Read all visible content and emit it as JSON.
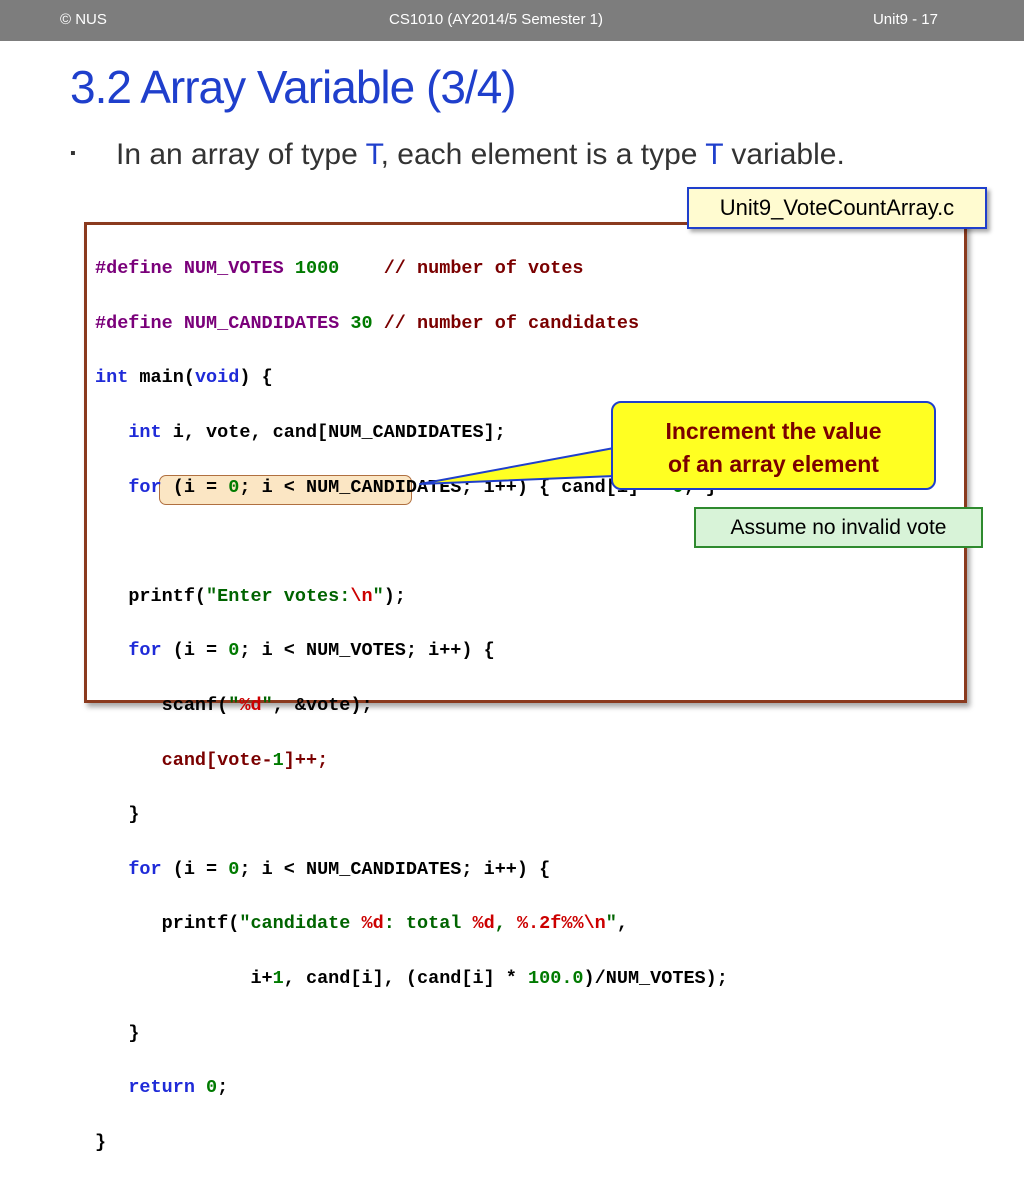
{
  "header": {
    "left": "© NUS",
    "center": "CS1010 (AY2014/5 Semester 1)",
    "right": "Unit9 - 17"
  },
  "title": "3.2 Array Variable (3/4)",
  "bullet": {
    "marker": "▪",
    "part1": "In an array of type ",
    "t1": "T",
    "part2": ", each element is a type ",
    "t2": "T",
    "part3": " variable."
  },
  "filename": "Unit9_VoteCountArray.c",
  "code": {
    "l1_define": "#define",
    "l1_name": "NUM_VOTES",
    "l1_value": "1000",
    "l1_comment": "// number of votes",
    "l2_define": "#define",
    "l2_name": "NUM_CANDIDATES",
    "l2_value": "30",
    "l2_comment": "// number of candidates",
    "l3_type": "int",
    "l3_main": " main(",
    "l3_void": "void",
    "l3_end": ") {",
    "l4_type": "int",
    "l4_rest": " i, vote, cand[NUM_CANDIDATES];",
    "l5_for": "for",
    "l5_a": " (i = ",
    "l5_zero": "0",
    "l5_b": "; i < NUM_CANDIDATES; i++) { cand[i] = ",
    "l5_zero2": "0",
    "l5_c": "; }",
    "l6_printf": "printf(",
    "l6_str": "\"Enter votes:",
    "l6_esc": "\\n",
    "l6_strend": "\"",
    "l6_end": ");",
    "l7_for": "for",
    "l7_a": " (i = ",
    "l7_zero": "0",
    "l7_b": "; i < NUM_VOTES; i++) {",
    "l8_scanf": "scanf(",
    "l8_q1": "\"",
    "l8_fmt": "%d",
    "l8_q2": "\"",
    "l8_end": ", &vote);",
    "l9_a": "cand[vote-",
    "l9_one": "1",
    "l9_b": "]++;",
    "l10": "}",
    "l11_for": "for",
    "l11_a": " (i = ",
    "l11_zero": "0",
    "l11_b": "; i < NUM_CANDIDATES; i++) {",
    "l12_printf": "printf(",
    "l12_s1": "\"candidate ",
    "l12_f1": "%d",
    "l12_s2": ": total ",
    "l12_f2": "%d",
    "l12_s3": ", ",
    "l12_f3": "%.2f%%",
    "l12_f4": "\\n",
    "l12_s4": "\"",
    "l12_end": ",",
    "l13_a": "i+",
    "l13_one": "1",
    "l13_b": ", cand[i], (cand[i] * ",
    "l13_num": "100.0",
    "l13_c": ")/NUM_VOTES);",
    "l14": "}",
    "l15_return": "return",
    "l15_zero": "0",
    "l15_end": ";",
    "l16": "}"
  },
  "callout": {
    "line1": "Increment the value",
    "line2": "of an array element"
  },
  "note": "Assume no invalid vote",
  "colors": {
    "title": "#1f3fcc",
    "topbar": "#7d7d7d",
    "callout_bg": "#ffff22",
    "note_bg": "#d8f3d8",
    "code_border": "#8a3a1e"
  }
}
